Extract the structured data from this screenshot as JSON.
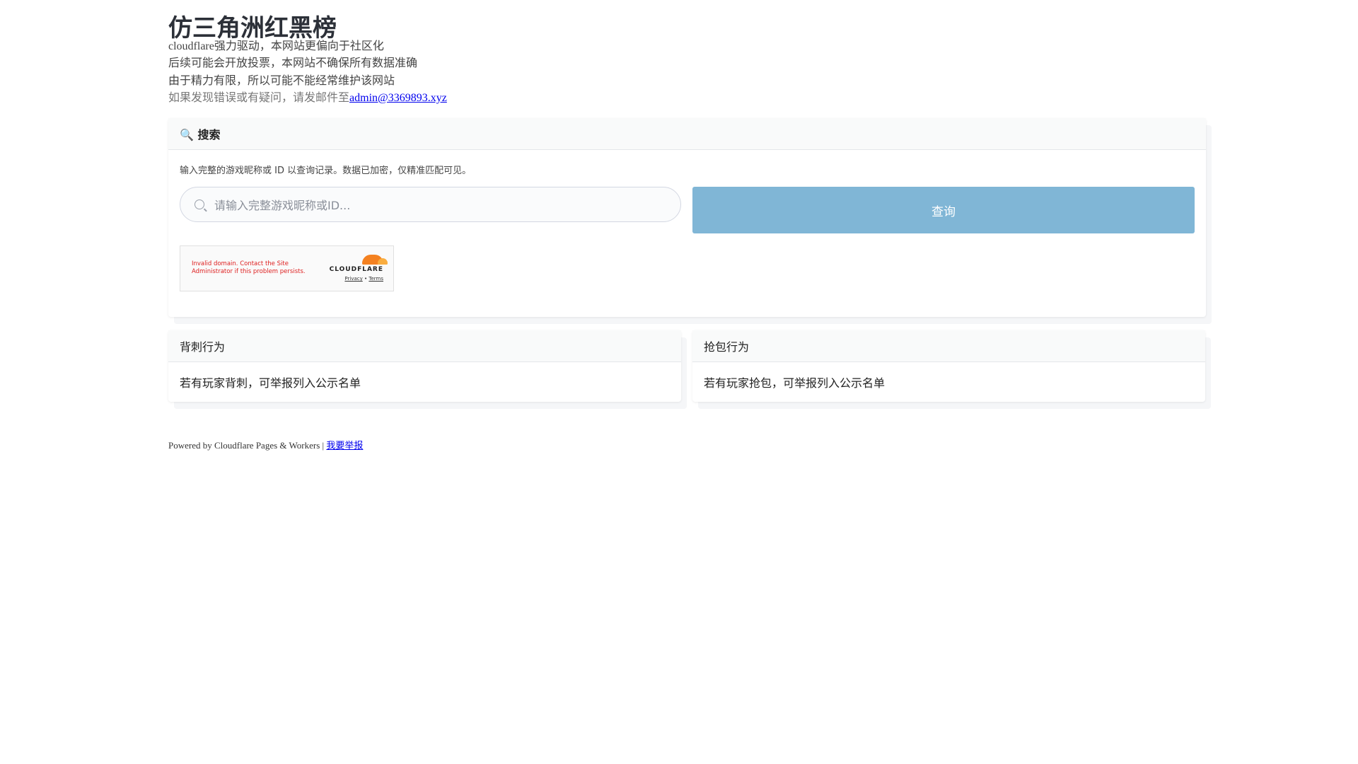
{
  "header": {
    "title": "仿三角洲红黑榜",
    "lines": [
      "cloudflare强力驱动，本网站更偏向于社区化",
      "后续可能会开放投票，本网站不确保所有数据准确",
      "由于精力有限，所以可能不能经常维护该网站"
    ],
    "contact_prefix": "如果发现错误或有疑问，请发邮件至",
    "contact_email": "admin@3369893.xyz"
  },
  "search": {
    "icon": "magnifier-emoji",
    "title": "🔍 搜索",
    "description": "输入完整的游戏昵称或 ID 以查询记录。数据已加密，仅精准匹配可见。",
    "placeholder": "请输入完整游戏昵称或ID...",
    "button_label": "查询",
    "button_color": "#80b6d6",
    "turnstile": {
      "error": "Invalid domain. Contact the Site Administrator if this problem persists.",
      "brand": "CLOUDFLARE",
      "privacy": "Privacy",
      "separator": "•",
      "terms": "Terms"
    }
  },
  "cards": [
    {
      "title": "背刺行为",
      "body": "若有玩家背刺，可举报列入公示名单"
    },
    {
      "title": "抢包行为",
      "body": "若有玩家抢包，可举报列入公示名单"
    }
  ],
  "footer": {
    "text": "Powered by Cloudflare Pages & Workers | ",
    "report_link": "我要举报"
  }
}
